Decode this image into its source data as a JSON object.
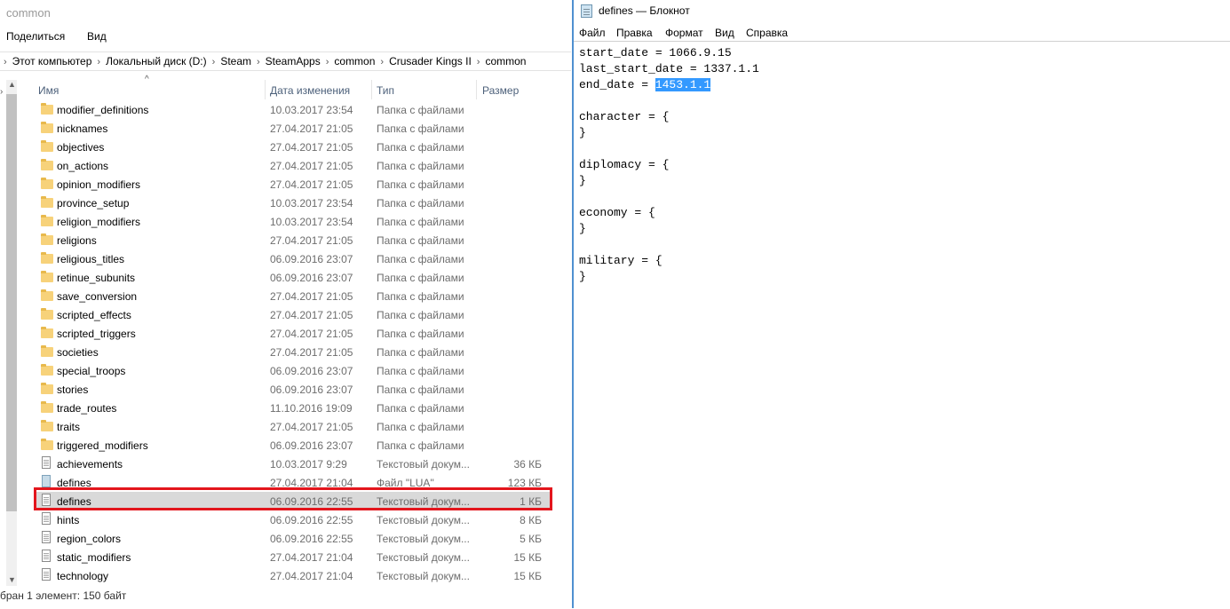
{
  "explorer": {
    "window_title": "common",
    "ribbon": {
      "share": "Поделиться",
      "view": "Вид"
    },
    "breadcrumb": [
      "Этот компьютер",
      "Локальный диск (D:)",
      "Steam",
      "SteamApps",
      "common",
      "Crusader Kings II",
      "common"
    ],
    "columns": {
      "name": "Имя",
      "date": "Дата изменения",
      "type": "Тип",
      "size": "Размер"
    },
    "files": [
      {
        "name": "modifier_definitions",
        "date": "10.03.2017 23:54",
        "type": "Папка с файлами",
        "size": "",
        "icon": "folder-icon"
      },
      {
        "name": "nicknames",
        "date": "27.04.2017 21:05",
        "type": "Папка с файлами",
        "size": "",
        "icon": "folder-icon"
      },
      {
        "name": "objectives",
        "date": "27.04.2017 21:05",
        "type": "Папка с файлами",
        "size": "",
        "icon": "folder-icon"
      },
      {
        "name": "on_actions",
        "date": "27.04.2017 21:05",
        "type": "Папка с файлами",
        "size": "",
        "icon": "folder-icon"
      },
      {
        "name": "opinion_modifiers",
        "date": "27.04.2017 21:05",
        "type": "Папка с файлами",
        "size": "",
        "icon": "folder-icon"
      },
      {
        "name": "province_setup",
        "date": "10.03.2017 23:54",
        "type": "Папка с файлами",
        "size": "",
        "icon": "folder-icon"
      },
      {
        "name": "religion_modifiers",
        "date": "10.03.2017 23:54",
        "type": "Папка с файлами",
        "size": "",
        "icon": "folder-icon"
      },
      {
        "name": "religions",
        "date": "27.04.2017 21:05",
        "type": "Папка с файлами",
        "size": "",
        "icon": "folder-icon"
      },
      {
        "name": "religious_titles",
        "date": "06.09.2016 23:07",
        "type": "Папка с файлами",
        "size": "",
        "icon": "folder-icon"
      },
      {
        "name": "retinue_subunits",
        "date": "06.09.2016 23:07",
        "type": "Папка с файлами",
        "size": "",
        "icon": "folder-icon"
      },
      {
        "name": "save_conversion",
        "date": "27.04.2017 21:05",
        "type": "Папка с файлами",
        "size": "",
        "icon": "folder-icon"
      },
      {
        "name": "scripted_effects",
        "date": "27.04.2017 21:05",
        "type": "Папка с файлами",
        "size": "",
        "icon": "folder-icon"
      },
      {
        "name": "scripted_triggers",
        "date": "27.04.2017 21:05",
        "type": "Папка с файлами",
        "size": "",
        "icon": "folder-icon"
      },
      {
        "name": "societies",
        "date": "27.04.2017 21:05",
        "type": "Папка с файлами",
        "size": "",
        "icon": "folder-icon"
      },
      {
        "name": "special_troops",
        "date": "06.09.2016 23:07",
        "type": "Папка с файлами",
        "size": "",
        "icon": "folder-icon"
      },
      {
        "name": "stories",
        "date": "06.09.2016 23:07",
        "type": "Папка с файлами",
        "size": "",
        "icon": "folder-icon"
      },
      {
        "name": "trade_routes",
        "date": "11.10.2016 19:09",
        "type": "Папка с файлами",
        "size": "",
        "icon": "folder-icon"
      },
      {
        "name": "traits",
        "date": "27.04.2017 21:05",
        "type": "Папка с файлами",
        "size": "",
        "icon": "folder-icon"
      },
      {
        "name": "triggered_modifiers",
        "date": "06.09.2016 23:07",
        "type": "Папка с файлами",
        "size": "",
        "icon": "folder-icon"
      },
      {
        "name": "achievements",
        "date": "10.03.2017 9:29",
        "type": "Текстовый докум...",
        "size": "36 КБ",
        "icon": "text-file-icon"
      },
      {
        "name": "defines",
        "date": "27.04.2017 21:04",
        "type": "Файл \"LUA\"",
        "size": "123 КБ",
        "icon": "lua-file-icon"
      },
      {
        "name": "defines",
        "date": "06.09.2016 22:55",
        "type": "Текстовый докум...",
        "size": "1 КБ",
        "icon": "text-file-icon",
        "selected": true
      },
      {
        "name": "hints",
        "date": "06.09.2016 22:55",
        "type": "Текстовый докум...",
        "size": "8 КБ",
        "icon": "text-file-icon"
      },
      {
        "name": "region_colors",
        "date": "06.09.2016 22:55",
        "type": "Текстовый докум...",
        "size": "5 КБ",
        "icon": "text-file-icon"
      },
      {
        "name": "static_modifiers",
        "date": "27.04.2017 21:04",
        "type": "Текстовый докум...",
        "size": "15 КБ",
        "icon": "text-file-icon"
      },
      {
        "name": "technology",
        "date": "27.04.2017 21:04",
        "type": "Текстовый докум...",
        "size": "15 КБ",
        "icon": "text-file-icon"
      }
    ],
    "status": "бран 1 элемент: 150 байт",
    "highlight_color": "#e3161d"
  },
  "notepad": {
    "title": "defines — Блокнот",
    "menu": [
      "Файл",
      "Правка",
      "Формат",
      "Вид",
      "Справка"
    ],
    "lines": [
      {
        "text": "start_date = 1066.9.15"
      },
      {
        "text": "last_start_date = 1337.1.1"
      },
      {
        "text": "end_date = ",
        "selected_text": "1453.1.1"
      },
      {
        "text": ""
      },
      {
        "text": "character = {"
      },
      {
        "text": "}"
      },
      {
        "text": ""
      },
      {
        "text": "diplomacy = {"
      },
      {
        "text": "}"
      },
      {
        "text": ""
      },
      {
        "text": "economy = {"
      },
      {
        "text": "}"
      },
      {
        "text": ""
      },
      {
        "text": "military = {"
      },
      {
        "text": "}"
      }
    ],
    "selection_color": "#3399ff"
  }
}
